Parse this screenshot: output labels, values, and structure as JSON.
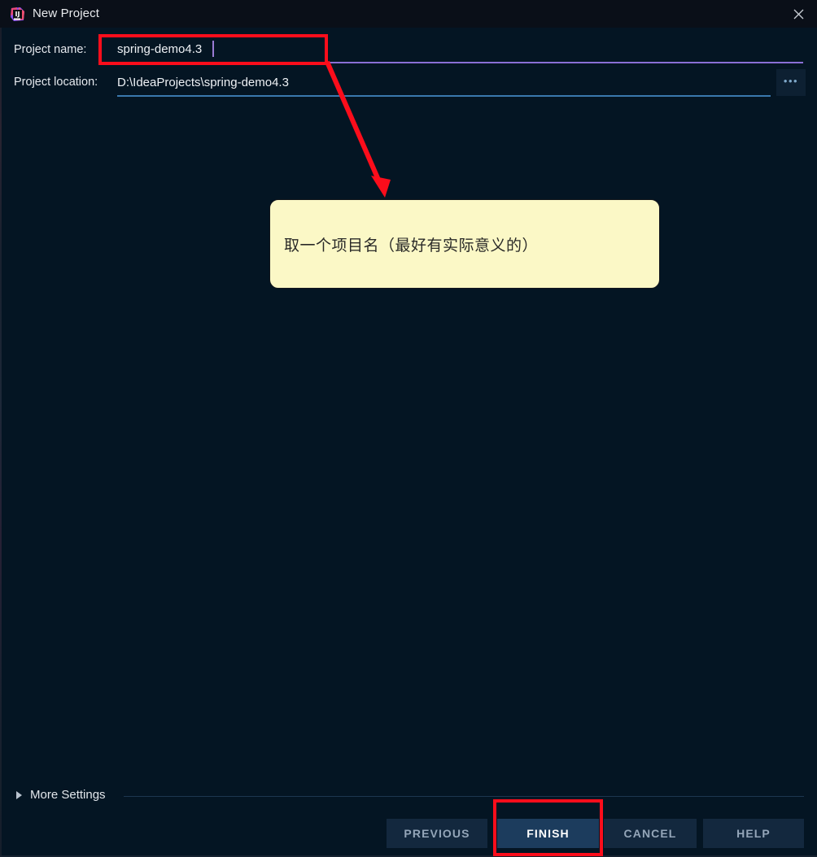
{
  "window": {
    "title": "New Project",
    "app_icon": "intellij-idea-icon",
    "close_icon": "close-icon",
    "bg_color": "#041523",
    "titlebar_color": "#0a0f18"
  },
  "form": {
    "name_label": "Project name:",
    "name_value": "spring-demo4.3",
    "name_underline_color": "#8a6fd6",
    "location_label": "Project location:",
    "location_value": "D:\\IdeaProjects\\spring-demo4.3",
    "location_underline_color": "#3a78ad",
    "browse_label": "•••",
    "browse_icon": "ellipsis-icon"
  },
  "annotation": {
    "color": "#fc0d1b",
    "note_text": "取一个项目名（最好有实际意义的）",
    "note_bg": "#fbf8c6",
    "arrow_icon": "red-arrow-icon",
    "highlight_name_field": true,
    "highlight_finish_button": true
  },
  "more_settings": {
    "label": "More Settings",
    "expander_icon": "triangle-right-icon",
    "expanded": false
  },
  "buttons": {
    "previous": "PREVIOUS",
    "finish": "FINISH",
    "cancel": "CANCEL",
    "help": "HELP",
    "default_button": "FINISH"
  }
}
